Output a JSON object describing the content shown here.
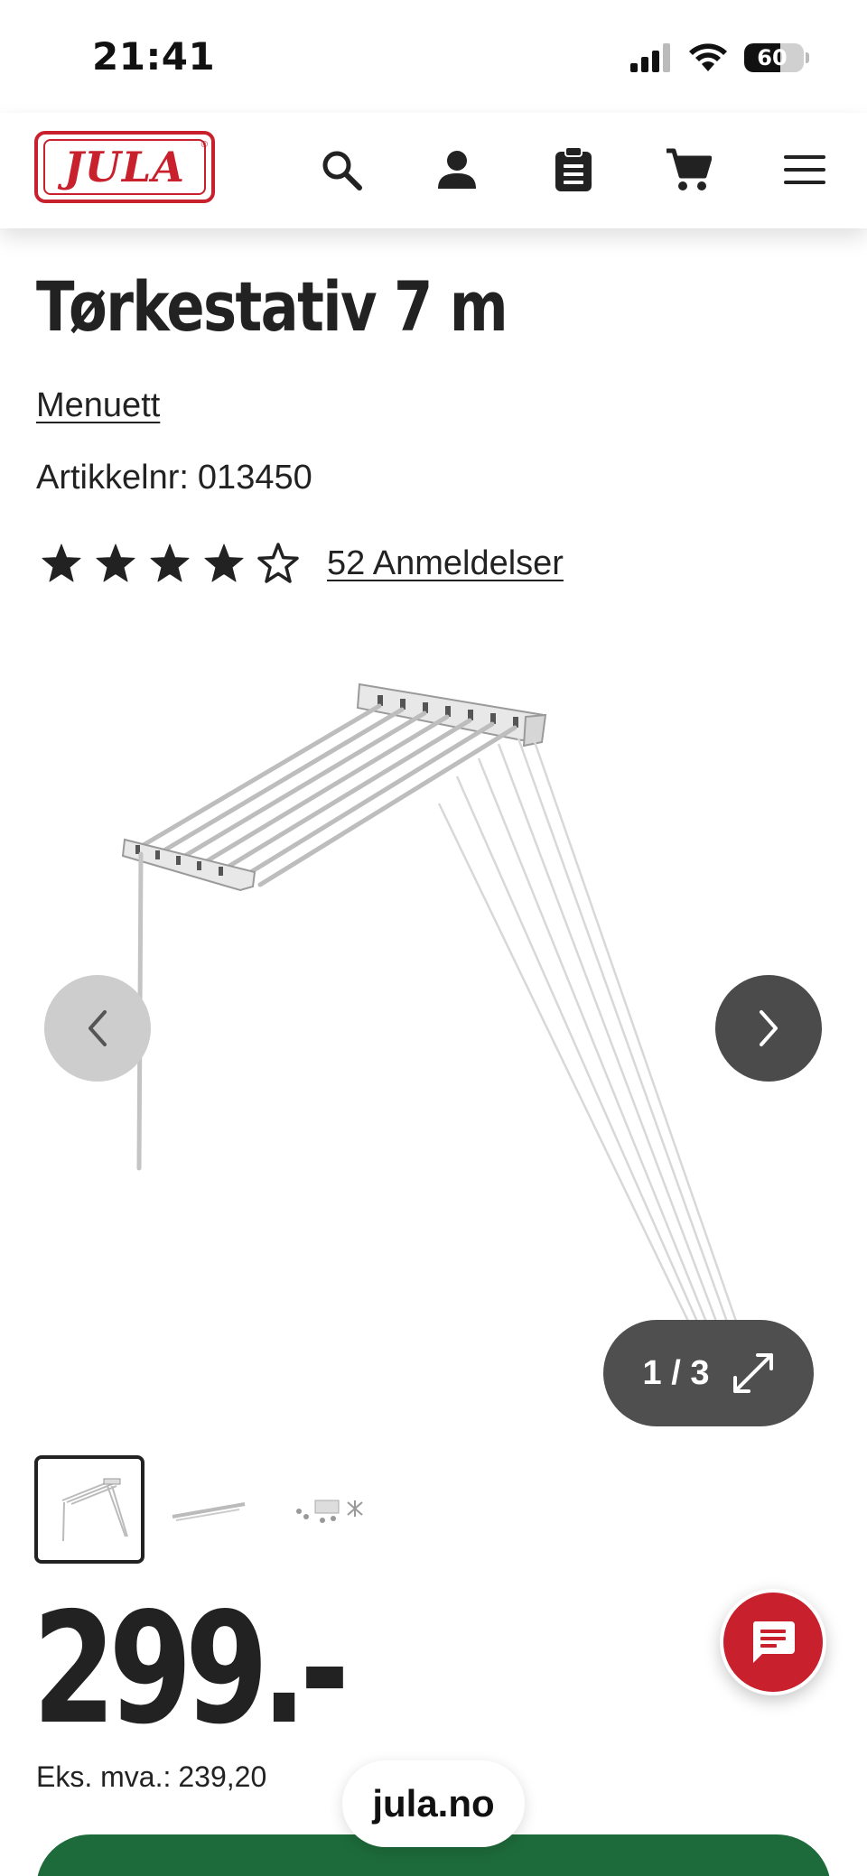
{
  "status_bar": {
    "time": "21:41",
    "battery_level": "60",
    "battery_fraction": 0.6
  },
  "header": {
    "logo_text": "JULA",
    "icons": [
      "search-icon",
      "account-icon",
      "clipboard-icon",
      "cart-icon",
      "menu-icon"
    ]
  },
  "product": {
    "title": "Tørkestativ 7 m",
    "brand": "Menuett",
    "sku_label": "Artikkelnr:",
    "sku": "013450",
    "rating": {
      "value": 4,
      "max": 5
    },
    "reviews_link": "52 Anmeldelser"
  },
  "gallery": {
    "counter": "1 / 3",
    "current": 1,
    "total": 3
  },
  "price": {
    "amount": "299.-",
    "ex_vat_label": "Eks. mva.:",
    "ex_vat_value": "239,20"
  },
  "browser": {
    "url": "jula.no"
  },
  "colors": {
    "brand_red": "#c8202c",
    "buy_green": "#1d6b3a",
    "text": "#222222"
  }
}
